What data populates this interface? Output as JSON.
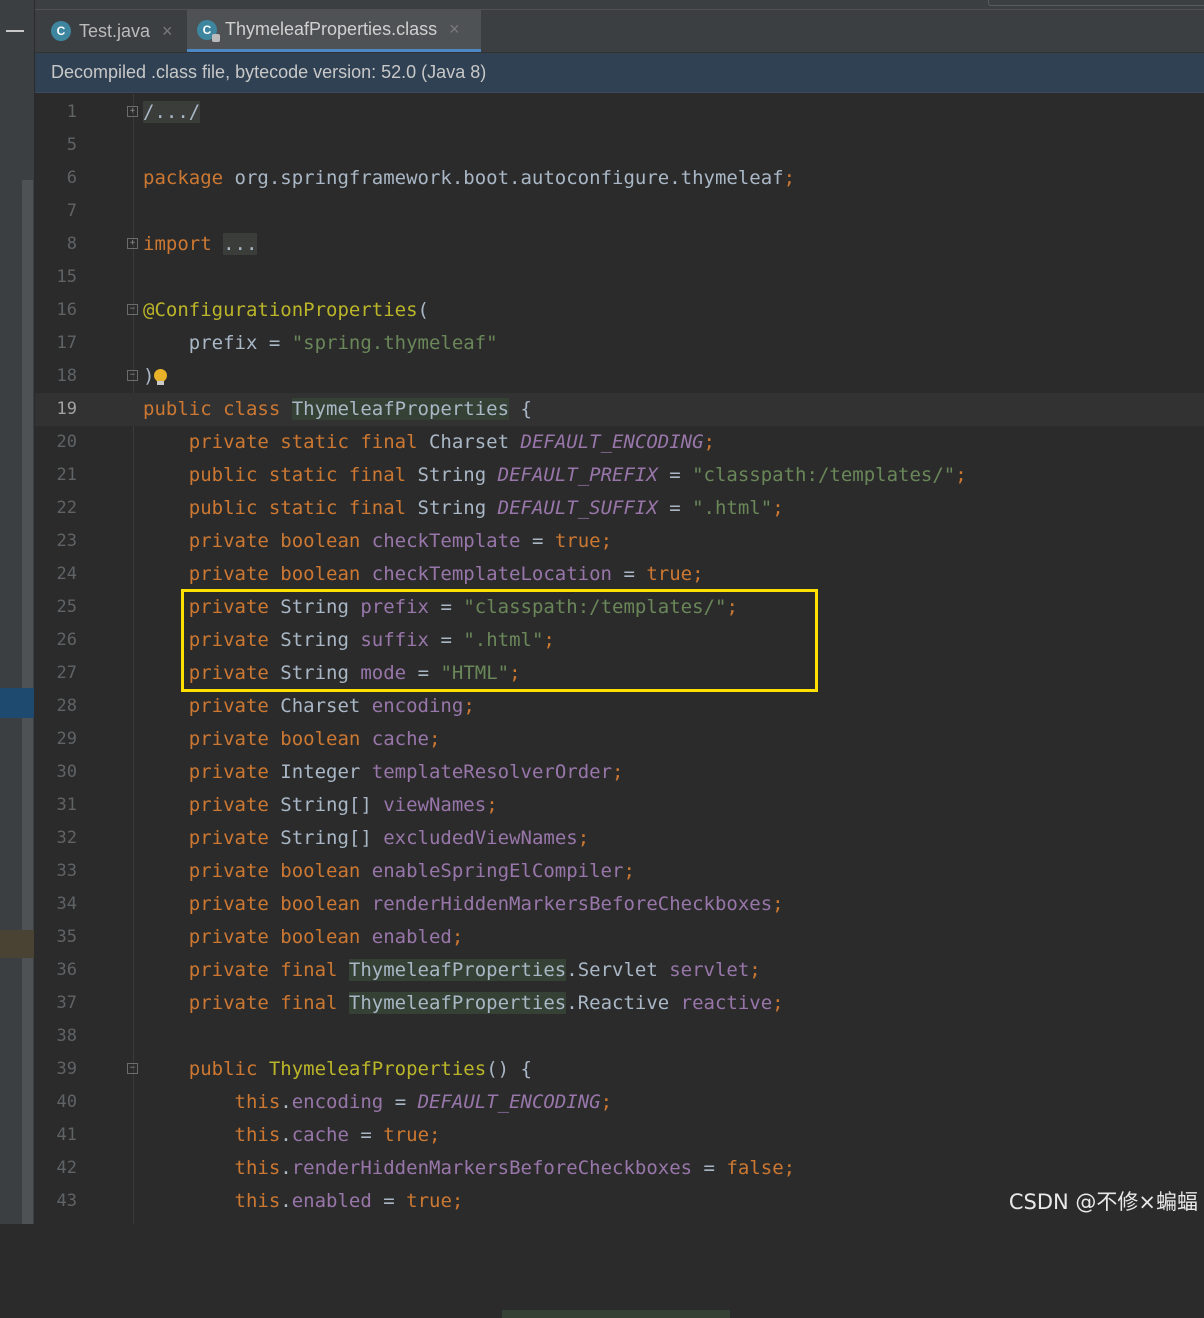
{
  "tabs": [
    {
      "label": "Test.java",
      "icon": "java-class-icon"
    },
    {
      "label": "ThymeleafProperties.class",
      "icon": "compiled-class-icon"
    }
  ],
  "banner": "Decompiled .class file, bytecode version: 52.0 (Java 8)",
  "watermark": "CSDN @不修×蝙蝠",
  "colors": {
    "keyword": "#cc7832",
    "string": "#6a8759",
    "annotation": "#bbb529",
    "field": "#9876aa",
    "text": "#a9b7c6",
    "highlight_box": "#ffe000"
  },
  "code_lines": [
    {
      "n": "1",
      "segs": [
        [
          "fold-text",
          "/.../"
        ]
      ]
    },
    {
      "n": "5",
      "segs": []
    },
    {
      "n": "6",
      "segs": [
        [
          "kw",
          "package "
        ],
        [
          "",
          "org.springframework.boot.autoconfigure.thymeleaf"
        ],
        [
          "kw",
          ";"
        ]
      ]
    },
    {
      "n": "7",
      "segs": []
    },
    {
      "n": "8",
      "segs": [
        [
          "kw",
          "import "
        ],
        [
          "fold-text",
          "..."
        ]
      ]
    },
    {
      "n": "15",
      "segs": []
    },
    {
      "n": "16",
      "segs": [
        [
          "ann",
          "@ConfigurationProperties"
        ],
        [
          "",
          "("
        ]
      ]
    },
    {
      "n": "17",
      "segs": [
        [
          "",
          "    prefix = "
        ],
        [
          "str",
          "\"spring.thymeleaf\""
        ]
      ]
    },
    {
      "n": "18",
      "segs": [
        [
          "",
          ")"
        ]
      ]
    },
    {
      "n": "19",
      "segs": [
        [
          "kw",
          "public class "
        ],
        [
          "hl",
          "ThymeleafProperties"
        ],
        [
          "",
          " {"
        ]
      ]
    },
    {
      "n": "20",
      "segs": [
        [
          "kw",
          "    private static final "
        ],
        [
          "",
          "Charset "
        ],
        [
          "sfld",
          "DEFAULT_ENCODING"
        ],
        [
          "kw",
          ";"
        ]
      ]
    },
    {
      "n": "21",
      "segs": [
        [
          "kw",
          "    public static final "
        ],
        [
          "",
          "String "
        ],
        [
          "sfld",
          "DEFAULT_PREFIX"
        ],
        [
          "",
          " = "
        ],
        [
          "str",
          "\"classpath:/templates/\""
        ],
        [
          "kw",
          ";"
        ]
      ]
    },
    {
      "n": "22",
      "segs": [
        [
          "kw",
          "    public static final "
        ],
        [
          "",
          "String "
        ],
        [
          "sfld",
          "DEFAULT_SUFFIX"
        ],
        [
          "",
          " = "
        ],
        [
          "str",
          "\".html\""
        ],
        [
          "kw",
          ";"
        ]
      ]
    },
    {
      "n": "23",
      "segs": [
        [
          "kw",
          "    private boolean "
        ],
        [
          "fld",
          "checkTemplate"
        ],
        [
          "",
          " = "
        ],
        [
          "kw",
          "true;"
        ]
      ]
    },
    {
      "n": "24",
      "segs": [
        [
          "kw",
          "    private boolean "
        ],
        [
          "fld",
          "checkTemplateLocation"
        ],
        [
          "",
          " = "
        ],
        [
          "kw",
          "true;"
        ]
      ]
    },
    {
      "n": "25",
      "segs": [
        [
          "kw",
          "    private "
        ],
        [
          "",
          "String "
        ],
        [
          "fld",
          "prefix"
        ],
        [
          "",
          " = "
        ],
        [
          "str",
          "\"classpath:/templates/\""
        ],
        [
          "kw",
          ";"
        ]
      ]
    },
    {
      "n": "26",
      "segs": [
        [
          "kw",
          "    private "
        ],
        [
          "",
          "String "
        ],
        [
          "fld",
          "suffix"
        ],
        [
          "",
          " = "
        ],
        [
          "str",
          "\".html\""
        ],
        [
          "kw",
          ";"
        ]
      ]
    },
    {
      "n": "27",
      "segs": [
        [
          "kw",
          "    private "
        ],
        [
          "",
          "String "
        ],
        [
          "fld",
          "mode"
        ],
        [
          "",
          " = "
        ],
        [
          "str",
          "\"HTML\""
        ],
        [
          "kw",
          ";"
        ]
      ]
    },
    {
      "n": "28",
      "segs": [
        [
          "kw",
          "    private "
        ],
        [
          "",
          "Charset "
        ],
        [
          "fld",
          "encoding"
        ],
        [
          "kw",
          ";"
        ]
      ]
    },
    {
      "n": "29",
      "segs": [
        [
          "kw",
          "    private boolean "
        ],
        [
          "fld",
          "cache"
        ],
        [
          "kw",
          ";"
        ]
      ]
    },
    {
      "n": "30",
      "segs": [
        [
          "kw",
          "    private "
        ],
        [
          "",
          "Integer "
        ],
        [
          "fld",
          "templateResolverOrder"
        ],
        [
          "kw",
          ";"
        ]
      ]
    },
    {
      "n": "31",
      "segs": [
        [
          "kw",
          "    private "
        ],
        [
          "",
          "String[] "
        ],
        [
          "fld",
          "viewNames"
        ],
        [
          "kw",
          ";"
        ]
      ]
    },
    {
      "n": "32",
      "segs": [
        [
          "kw",
          "    private "
        ],
        [
          "",
          "String[] "
        ],
        [
          "fld",
          "excludedViewNames"
        ],
        [
          "kw",
          ";"
        ]
      ]
    },
    {
      "n": "33",
      "segs": [
        [
          "kw",
          "    private boolean "
        ],
        [
          "fld",
          "enableSpringElCompiler"
        ],
        [
          "kw",
          ";"
        ]
      ]
    },
    {
      "n": "34",
      "segs": [
        [
          "kw",
          "    private boolean "
        ],
        [
          "fld",
          "renderHiddenMarkersBeforeCheckboxes"
        ],
        [
          "kw",
          ";"
        ]
      ]
    },
    {
      "n": "35",
      "segs": [
        [
          "kw",
          "    private boolean "
        ],
        [
          "fld",
          "enabled"
        ],
        [
          "kw",
          ";"
        ]
      ]
    },
    {
      "n": "36",
      "segs": [
        [
          "kw",
          "    private final "
        ],
        [
          "hl",
          "ThymeleafProperties"
        ],
        [
          "",
          ".Servlet "
        ],
        [
          "fld",
          "servlet"
        ],
        [
          "kw",
          ";"
        ]
      ]
    },
    {
      "n": "37",
      "segs": [
        [
          "kw",
          "    private final "
        ],
        [
          "hl",
          "ThymeleafProperties"
        ],
        [
          "",
          ".Reactive "
        ],
        [
          "fld",
          "reactive"
        ],
        [
          "kw",
          ";"
        ]
      ]
    },
    {
      "n": "38",
      "segs": []
    },
    {
      "n": "39",
      "segs": [
        [
          "kw",
          "    public "
        ],
        [
          "ann",
          "ThymeleafProperties"
        ],
        [
          "",
          "() {"
        ]
      ]
    },
    {
      "n": "40",
      "segs": [
        [
          "kw",
          "        this"
        ],
        [
          "",
          "."
        ],
        [
          "fld",
          "encoding"
        ],
        [
          "",
          " = "
        ],
        [
          "sfld",
          "DEFAULT_ENCODING"
        ],
        [
          "kw",
          ";"
        ]
      ]
    },
    {
      "n": "41",
      "segs": [
        [
          "kw",
          "        this"
        ],
        [
          "",
          "."
        ],
        [
          "fld",
          "cache"
        ],
        [
          "",
          " = "
        ],
        [
          "kw",
          "true;"
        ]
      ]
    },
    {
      "n": "42",
      "segs": [
        [
          "kw",
          "        this"
        ],
        [
          "",
          "."
        ],
        [
          "fld",
          "renderHiddenMarkersBeforeCheckboxes"
        ],
        [
          "",
          " = "
        ],
        [
          "kw",
          "false;"
        ]
      ]
    },
    {
      "n": "43",
      "segs": [
        [
          "kw",
          "        this"
        ],
        [
          "",
          "."
        ],
        [
          "fld",
          "enabled"
        ],
        [
          "",
          " = "
        ],
        [
          "kw",
          "true;"
        ]
      ]
    }
  ]
}
